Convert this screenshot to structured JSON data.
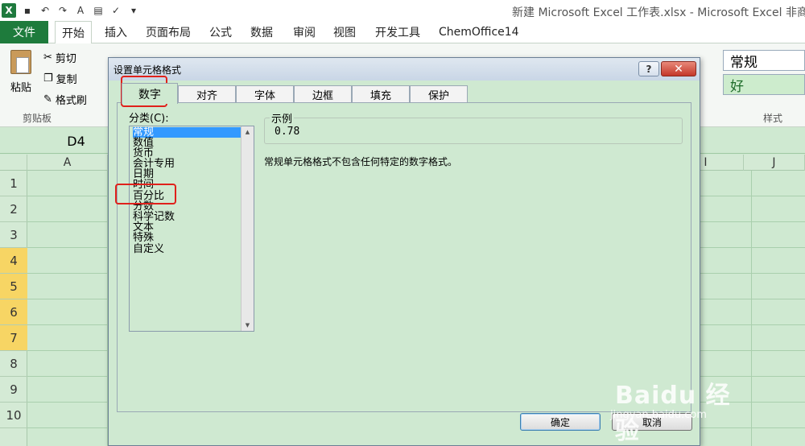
{
  "excel": {
    "window_title": "新建 Microsoft Excel 工作表.xlsx - Microsoft Excel 非商业",
    "file_tab": "文件",
    "ribbon_tabs": [
      "开始",
      "插入",
      "页面布局",
      "公式",
      "数据",
      "审阅",
      "视图",
      "开发工具",
      "ChemOffice14"
    ],
    "clipboard": {
      "paste": "粘贴",
      "cut": "剪切",
      "copy": "复制",
      "format_painter": "格式刷",
      "group_label": "剪贴板"
    },
    "styles": {
      "normal": "常规",
      "good": "好",
      "group_label": "样式"
    },
    "name_box": "D4",
    "columns": [
      "A",
      "I",
      "J"
    ],
    "rows": [
      "1",
      "2",
      "3",
      "4",
      "5",
      "6",
      "7",
      "8",
      "9",
      "10"
    ]
  },
  "dialog": {
    "title": "设置单元格格式",
    "help": "?",
    "close": "✕",
    "tabs": [
      "数字",
      "对齐",
      "字体",
      "边框",
      "填充",
      "保护"
    ],
    "active_tab": "数字",
    "category_label": "分类(C):",
    "categories": [
      "常规",
      "数值",
      "货币",
      "会计专用",
      "日期",
      "时间",
      "百分比",
      "分数",
      "科学记数",
      "文本",
      "特殊",
      "自定义"
    ],
    "selected_category": "常规",
    "sample_label": "示例",
    "sample_value": "0.78",
    "description": "常规单元格格式不包含任何特定的数字格式。",
    "ok": "确定",
    "cancel": "取消"
  },
  "watermark": {
    "text": "Baidu 经验",
    "url": "jingyan.baidu.com"
  },
  "colors": {
    "sheet_bg": "#cfe9d1",
    "highlight": "#e0211b",
    "selection": "#3399ff",
    "row_selected": "#f7d564"
  }
}
